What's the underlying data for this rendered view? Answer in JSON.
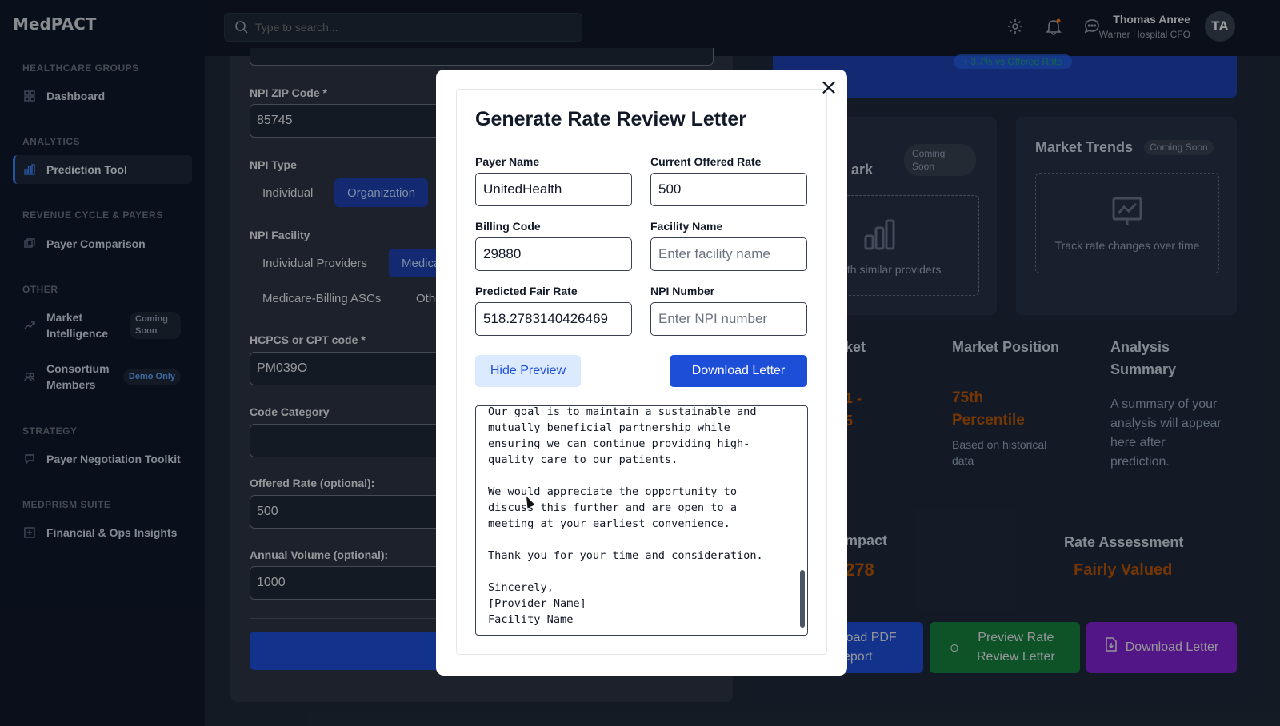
{
  "app": {
    "logo": "MedPACT"
  },
  "sidebar": {
    "sections": [
      {
        "title": "HEALTHCARE GROUPS"
      },
      {
        "title": "ANALYTICS"
      },
      {
        "title": "REVENUE CYCLE & PAYERS"
      },
      {
        "title": "OTHER"
      },
      {
        "title": "STRATEGY"
      },
      {
        "title": "MEDPRISM SUITE"
      }
    ],
    "items": [
      {
        "label": "Dashboard",
        "icon": "grid-icon"
      },
      {
        "label": "Prediction Tool",
        "icon": "bar-chart-icon",
        "active": true
      },
      {
        "label": "Payer Comparison",
        "icon": "cards-icon"
      },
      {
        "label": "Market Intelligence",
        "icon": "trend-up-icon",
        "badge": "Coming Soon"
      },
      {
        "label": "Consortium Members",
        "icon": "users-icon",
        "badge": "Demo Only"
      },
      {
        "label": "Payer Negotiation Toolkit",
        "icon": "chat-icon"
      },
      {
        "label": "Financial & Ops Insights",
        "icon": "plus-square-icon"
      }
    ]
  },
  "header": {
    "search_placeholder": "Type to search...",
    "user_name": "Thomas Anree",
    "user_role": "Warner Hospital CFO",
    "avatar_initials": "TA"
  },
  "form": {
    "zip_label": "NPI ZIP Code *",
    "zip_value": "85745",
    "npi_type_label": "NPI Type",
    "npi_type_options": [
      "Individual",
      "Organization"
    ],
    "facility_label": "NPI Facility",
    "facility_options": [
      "Individual Providers",
      "Medica",
      "Medicare-Billing ASCs",
      "Othe"
    ],
    "hcpcs_label": "HCPCS or CPT code *",
    "hcpcs_value": "PM039O",
    "category_label": "Code Category",
    "offered_label": "Offered Rate (optional):",
    "offered_value": "500",
    "volume_label": "Annual Volume (optional):",
    "volume_value": "1000"
  },
  "right": {
    "banner_chip": "↑ 3.7% vs Offered Rate",
    "benchmark_partial": "ark",
    "benchmark_badge": "Coming Soon",
    "benchmark_desc_partial": "e with similar providers",
    "trends_title": "Market Trends",
    "trends_badge": "Coming Soon",
    "trends_desc": "Track rate changes over time",
    "market_partial": "ket",
    "market_value_partial1": "1 -",
    "market_value_partial2": "5",
    "position_title": "Market Position",
    "position_value": "75th Percentile",
    "position_note": "Based on historical data",
    "summary_title": "Analysis Summary",
    "summary_text": "A summary of your analysis will appear here after prediction.",
    "impact_partial": "mpact",
    "impact_value_partial": "278",
    "assessment_title": "Rate Assessment",
    "assessment_value": "Fairly Valued",
    "btn_pdf_partial": "load PDF eport",
    "btn_preview": "Preview Rate Review Letter",
    "btn_download": "Download Letter",
    "colors": {
      "green": "#15803d",
      "purple": "#7e22ce",
      "orange": "#b45309"
    }
  },
  "modal": {
    "title": "Generate Rate Review Letter",
    "payer_label": "Payer Name",
    "payer_value": "UnitedHealth",
    "offered_label": "Current Offered Rate",
    "offered_value": "500",
    "billing_label": "Billing Code",
    "billing_value": "29880",
    "facility_label": "Facility Name",
    "facility_placeholder": "Enter facility name",
    "fair_label": "Predicted Fair Rate",
    "fair_value": "518.2783140426469",
    "npi_label": "NPI Number",
    "npi_placeholder": "Enter NPI number",
    "hide_btn": "Hide Preview",
    "download_btn": "Download Letter",
    "close": "×",
    "preview_text": "Our goal is to maintain a sustainable and\nmutually beneficial partnership while\nensuring we can continue providing high-\nquality care to our patients.\n\nWe would appreciate the opportunity to\ndiscuss this further and are open to a\nmeeting at your earliest convenience.\n\nThank you for your time and consideration.\n\nSincerely,\n[Provider Name]\nFacility Name"
  }
}
